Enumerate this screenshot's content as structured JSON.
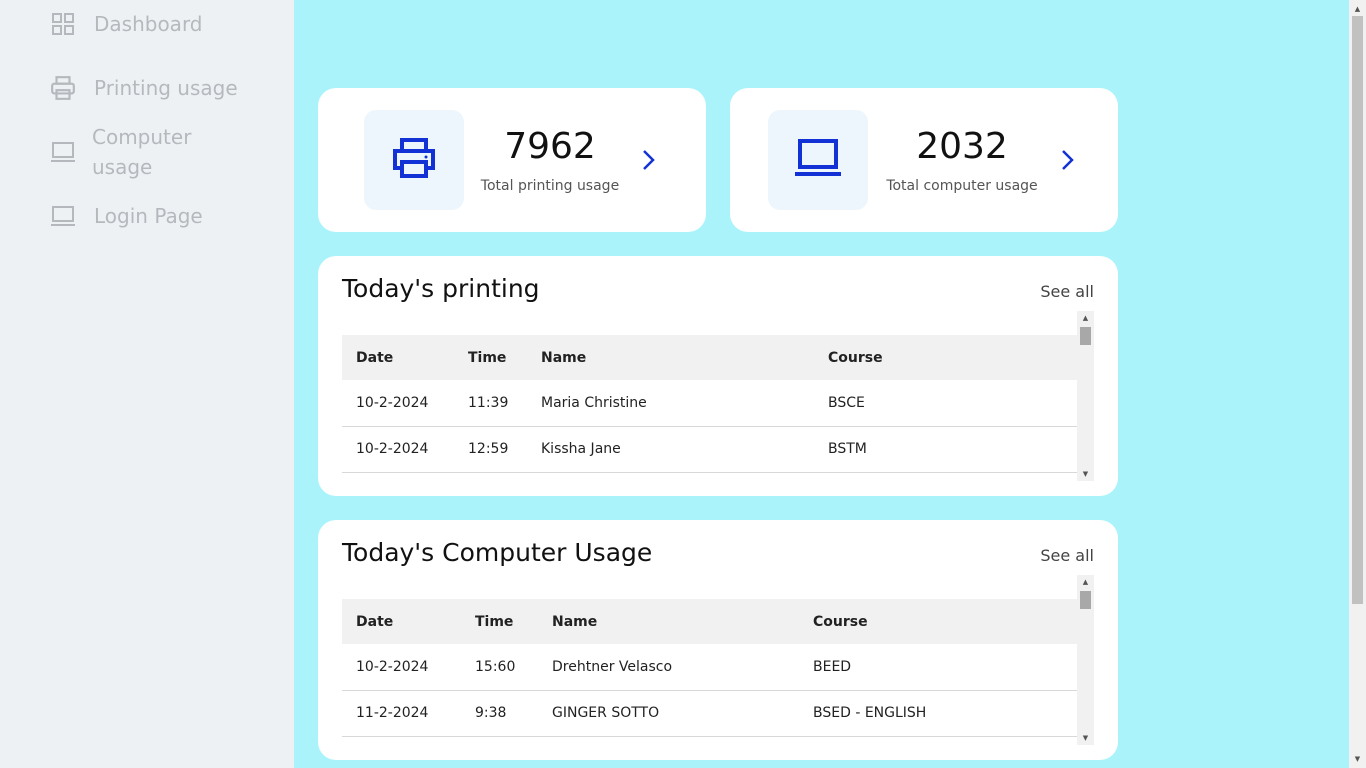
{
  "sidebar": {
    "items": [
      {
        "label": "Dashboard",
        "icon": "grid-icon"
      },
      {
        "label": "Printing usage",
        "icon": "printer-icon"
      },
      {
        "label": "Computer usage",
        "icon": "laptop-icon"
      },
      {
        "label": "Login Page",
        "icon": "laptop-icon"
      }
    ]
  },
  "stats": {
    "printing": {
      "value": "7962",
      "caption": "Total printing usage",
      "icon": "printer-icon"
    },
    "computer": {
      "value": "2032",
      "caption": "Total computer usage",
      "icon": "laptop-icon"
    }
  },
  "colors": {
    "accent": "#1232d6",
    "background": "#aaf3fb",
    "sidebar": "#eef1f4"
  },
  "printing_table": {
    "title": "Today's printing",
    "see_all": "See all",
    "headers": [
      "Date",
      "Time",
      "Name",
      "Course"
    ],
    "rows": [
      [
        "10-2-2024",
        "11:39",
        "Maria Christine",
        "BSCE"
      ],
      [
        "10-2-2024",
        "12:59",
        "Kissha Jane",
        "BSTM"
      ]
    ]
  },
  "computer_table": {
    "title": "Today's Computer Usage",
    "see_all": "See all",
    "headers": [
      "Date",
      "Time",
      "Name",
      "Course"
    ],
    "rows": [
      [
        "10-2-2024",
        "15:60",
        "Drehtner Velasco",
        "BEED"
      ],
      [
        "11-2-2024",
        "9:38",
        "GINGER SOTTO",
        "BSED - ENGLISH"
      ]
    ]
  }
}
